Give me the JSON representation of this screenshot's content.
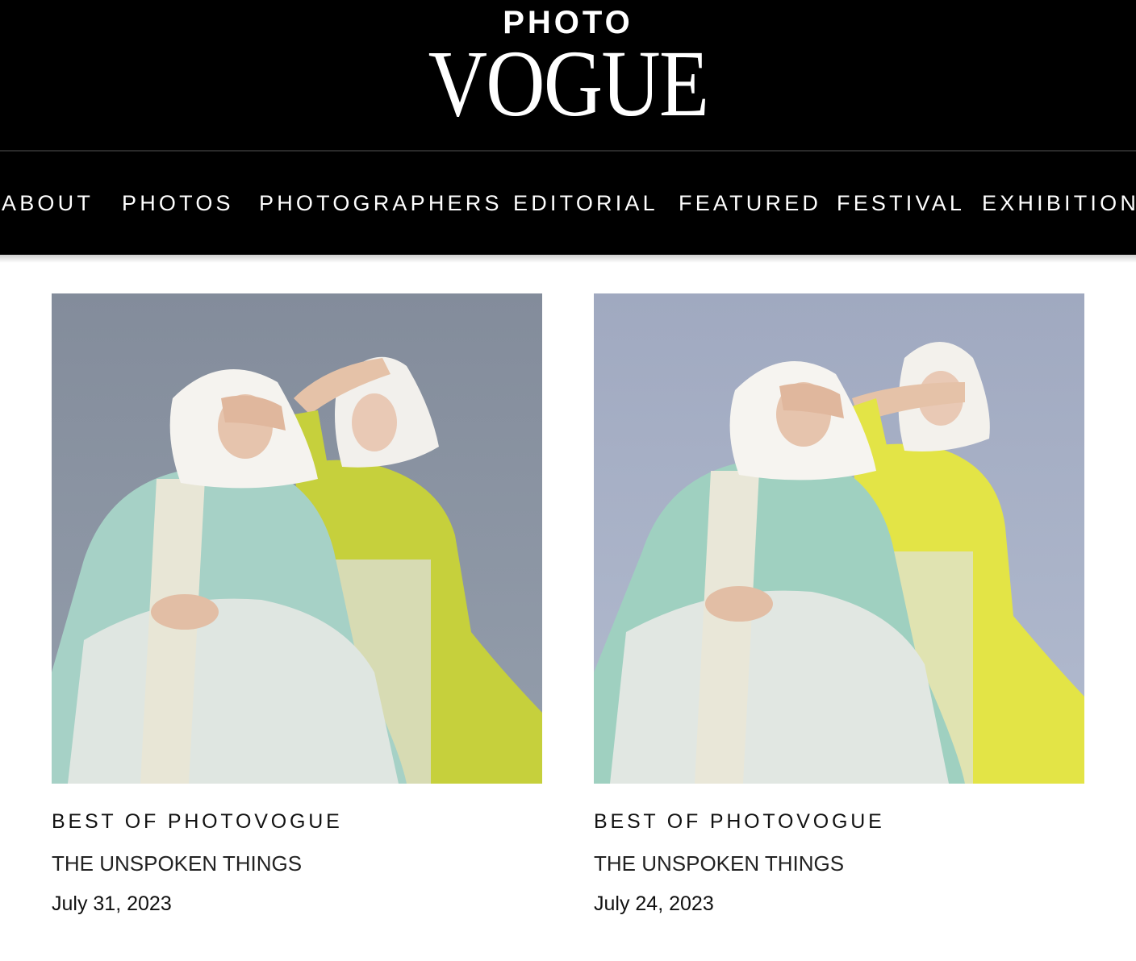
{
  "masthead": {
    "logo_top": "PHOTO",
    "logo_main": "VOGUE"
  },
  "nav": {
    "items": [
      {
        "label": "ABOUT"
      },
      {
        "label": "PHOTOS"
      },
      {
        "label": "PHOTOGRAPHERS"
      },
      {
        "label": "EDITORIAL"
      },
      {
        "label": "FEATURED"
      },
      {
        "label": "FESTIVAL"
      },
      {
        "label": "EXHIBITIONS"
      }
    ]
  },
  "cards": [
    {
      "kicker": "BEST OF PHOTOVOGUE",
      "title": "THE UNSPOKEN THINGS",
      "date": "July 31, 2023",
      "image": {
        "sky": "#8c95a3",
        "left_dress": "#a8d2c8",
        "right_dress": "#c9d23e"
      }
    },
    {
      "kicker": "BEST OF PHOTOVOGUE",
      "title": "THE UNSPOKEN THINGS",
      "date": "July 24, 2023",
      "image": {
        "sky": "#a5afc6",
        "left_dress": "#a2d2c2",
        "right_dress": "#e6e64a"
      }
    }
  ]
}
